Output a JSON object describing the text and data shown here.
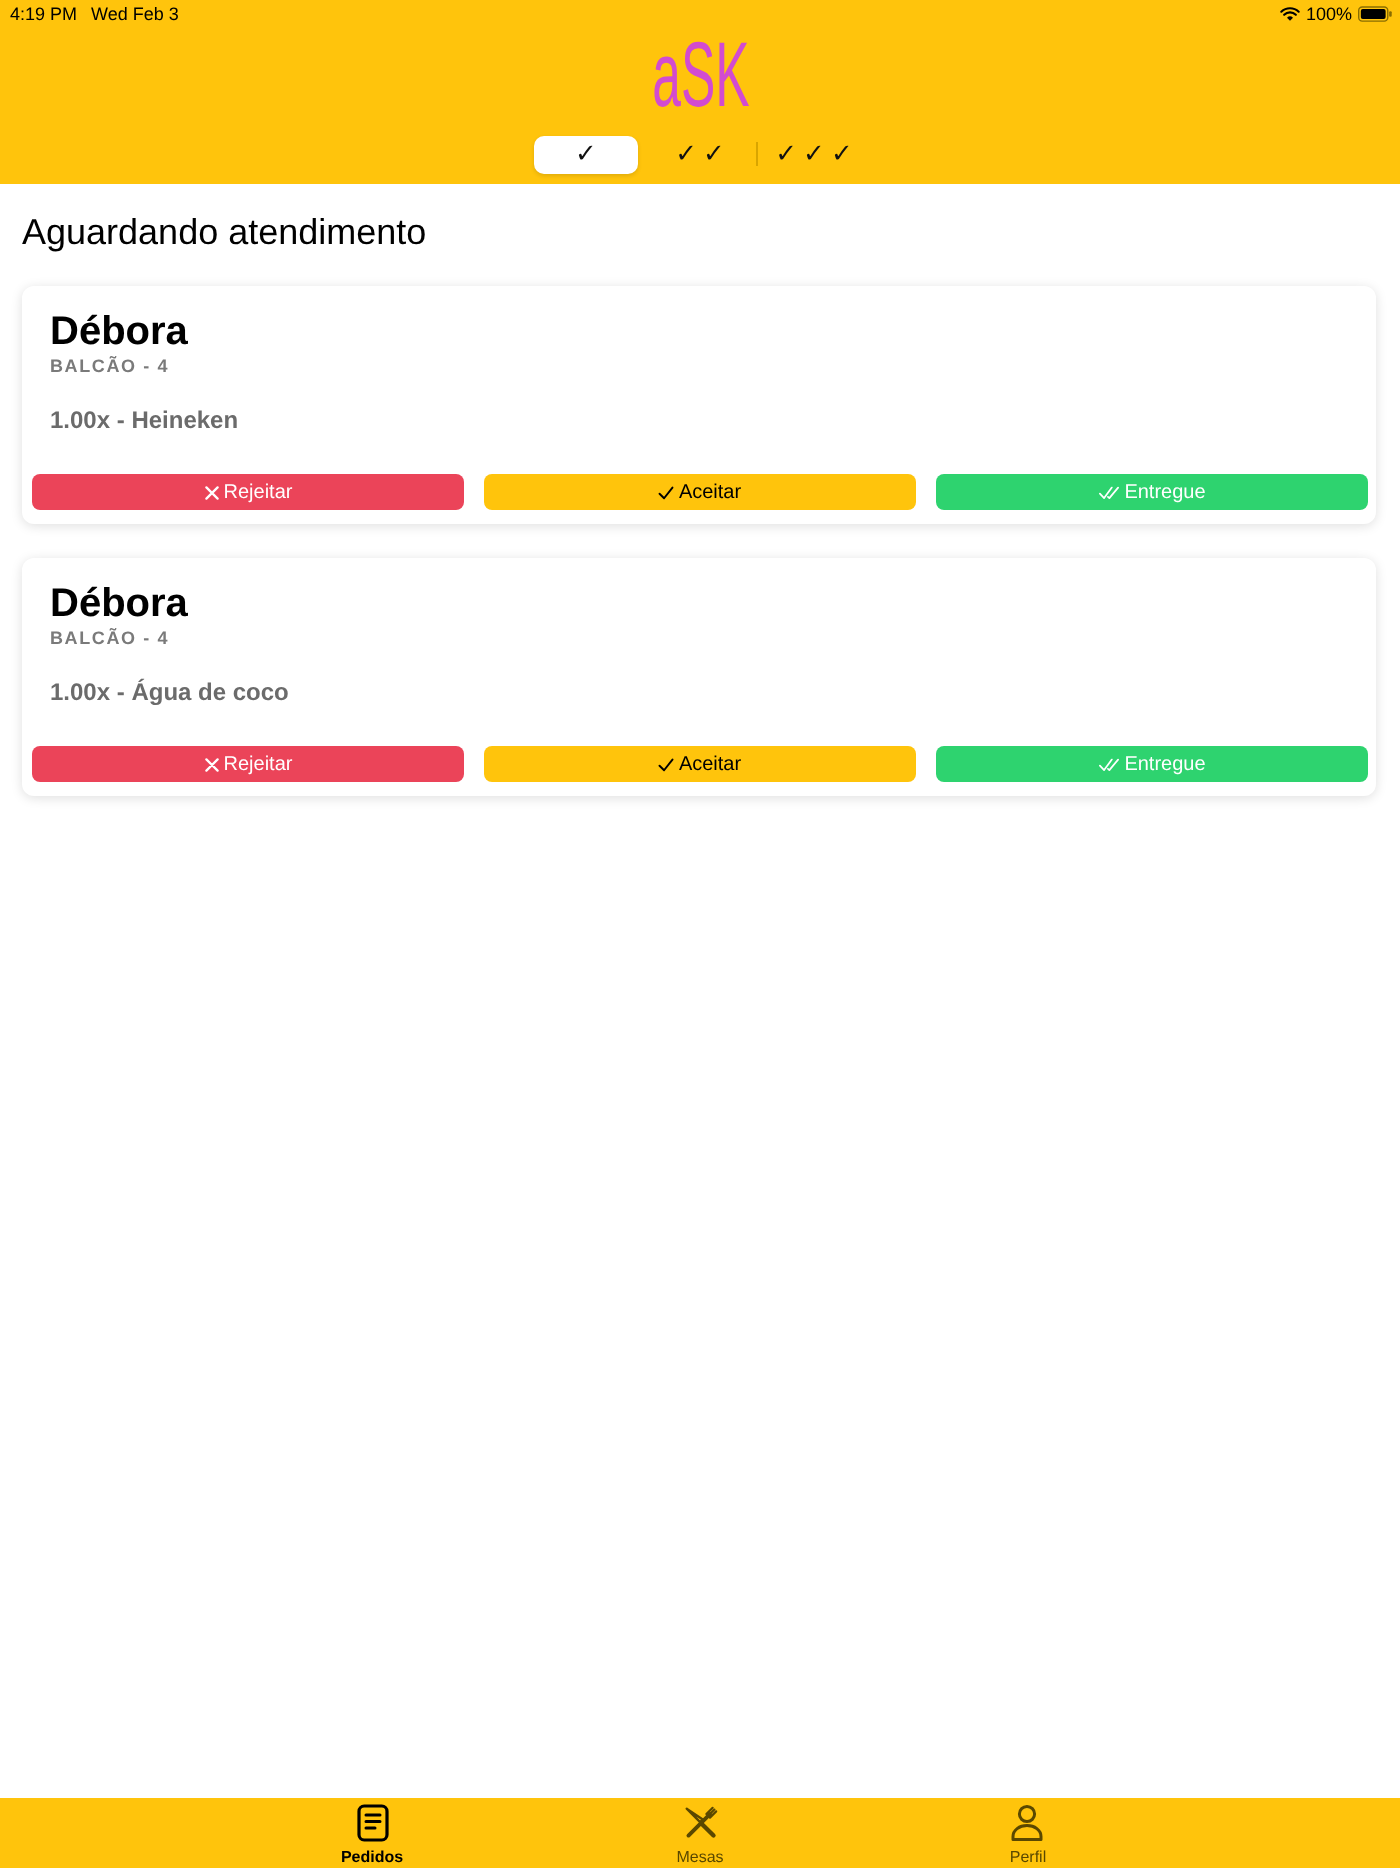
{
  "status_bar": {
    "time": "4:19 PM",
    "date": "Wed Feb 3",
    "battery": "100%"
  },
  "header": {
    "logo": "aSK",
    "tabs": [
      {
        "label": "✓",
        "selected": true
      },
      {
        "label": "✓✓",
        "selected": false
      },
      {
        "label": "✓✓✓",
        "selected": false
      }
    ]
  },
  "title": "Aguardando atendimento",
  "orders": [
    {
      "customer": "Débora",
      "location": "BALCÃO - 4",
      "items": [
        "1.00x - Heineken"
      ],
      "actions": [
        {
          "kind": "reject",
          "label": "Rejeitar"
        },
        {
          "kind": "accept",
          "label": "Aceitar"
        },
        {
          "kind": "deliver",
          "label": "Entregue"
        }
      ]
    },
    {
      "customer": "Débora",
      "location": "BALCÃO - 4",
      "items": [
        "1.00x - Água de coco"
      ],
      "actions": [
        {
          "kind": "reject",
          "label": "Rejeitar"
        },
        {
          "kind": "accept",
          "label": "Aceitar"
        },
        {
          "kind": "deliver",
          "label": "Entregue"
        }
      ]
    }
  ],
  "tab_bar": [
    {
      "kind": "orders",
      "label": "Pedidos",
      "selected": true
    },
    {
      "kind": "tables",
      "label": "Mesas",
      "selected": false
    },
    {
      "kind": "profile",
      "label": "Perfil",
      "selected": false
    }
  ]
}
